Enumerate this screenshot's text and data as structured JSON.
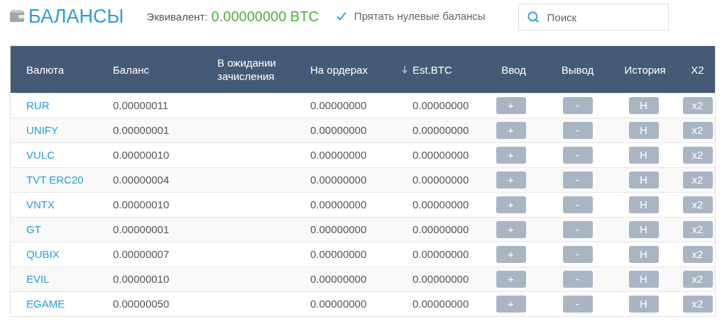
{
  "title": "БАЛАНСЫ",
  "equivalent": {
    "label": "Эквивалент:",
    "value": "0.00000000 BTC"
  },
  "hide_zero": {
    "label": "Прятать нулевые балансы",
    "checked": true
  },
  "search": {
    "placeholder": "Поиск"
  },
  "columns": [
    {
      "label": "Валюта",
      "sorted": false
    },
    {
      "label": "Баланс",
      "sorted": false
    },
    {
      "label": "В ожидании зачисления",
      "sorted": false
    },
    {
      "label": "На ордерах",
      "sorted": false
    },
    {
      "label": "Est.BTC",
      "sorted": true
    },
    {
      "label": "Ввод",
      "sorted": false
    },
    {
      "label": "Вывод",
      "sorted": false
    },
    {
      "label": "История",
      "sorted": false
    },
    {
      "label": "X2",
      "sorted": false
    }
  ],
  "rows": [
    {
      "currency": "RUR",
      "balance": "0.00000011",
      "orders": "0.00000000",
      "est_btc": "0.00000000",
      "actions": [
        "+",
        "-",
        "H",
        "x2"
      ]
    },
    {
      "currency": "UNIFY",
      "balance": "0.00000001",
      "orders": "0.00000000",
      "est_btc": "0.00000000",
      "actions": [
        "+",
        "-",
        "H",
        "x2"
      ]
    },
    {
      "currency": "VULC",
      "balance": "0.00000010",
      "orders": "0.00000000",
      "est_btc": "0.00000000",
      "actions": [
        "+",
        "-",
        "H",
        "x2"
      ]
    },
    {
      "currency": "TVT ERC20",
      "balance": "0.00000004",
      "orders": "0.00000000",
      "est_btc": "0.00000000",
      "actions": [
        "+",
        "-",
        "H",
        "x2"
      ]
    },
    {
      "currency": "VNTX",
      "balance": "0.00000010",
      "orders": "0.00000000",
      "est_btc": "0.00000000",
      "actions": [
        "+",
        "-",
        "H",
        "x2"
      ]
    },
    {
      "currency": "GT",
      "balance": "0.00000001",
      "orders": "0.00000000",
      "est_btc": "0.00000000",
      "actions": [
        "+",
        "-",
        "H",
        "x2"
      ]
    },
    {
      "currency": "QUBIX",
      "balance": "0.00000007",
      "orders": "0.00000000",
      "est_btc": "0.00000000",
      "actions": [
        "+",
        "-",
        "H",
        "x2"
      ]
    },
    {
      "currency": "EVIL",
      "balance": "0.00000010",
      "orders": "0.00000000",
      "est_btc": "0.00000000",
      "actions": [
        "+",
        "-",
        "H",
        "x2"
      ]
    },
    {
      "currency": "EGAME",
      "balance": "0.00000050",
      "orders": "0.00000000",
      "est_btc": "0.00000000",
      "actions": [
        "+",
        "-",
        "H",
        "x2"
      ]
    }
  ]
}
